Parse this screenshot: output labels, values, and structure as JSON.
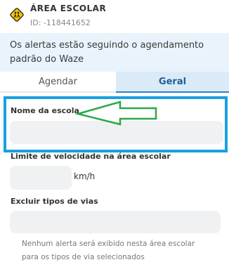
{
  "header": {
    "icon": "school-zone-icon",
    "title": "ÁREA ESCOLAR",
    "subtitle": "ID: -118441652"
  },
  "banner": {
    "text": "Os alertas estão seguindo o agendamento padrão do Waze"
  },
  "tabs": [
    {
      "label": "Agendar",
      "active": false
    },
    {
      "label": "Geral",
      "active": true
    }
  ],
  "form": {
    "name_label": "Nome da escola",
    "name_value": "",
    "speed_label": "Limite de velocidade na área escolar",
    "speed_value": "",
    "speed_unit": "km/h",
    "exclude_label": "Excluir tipos de vias",
    "exclude_value": "",
    "exclude_help": "Nenhum alerta será exibido nesta área escolar para os tipos de via selecionados"
  },
  "colors": {
    "highlight": "#19a0e0",
    "arrow": "#2aa84a",
    "active_tab_bg": "#dbeaf7",
    "banner_bg": "#e9f3fb"
  }
}
